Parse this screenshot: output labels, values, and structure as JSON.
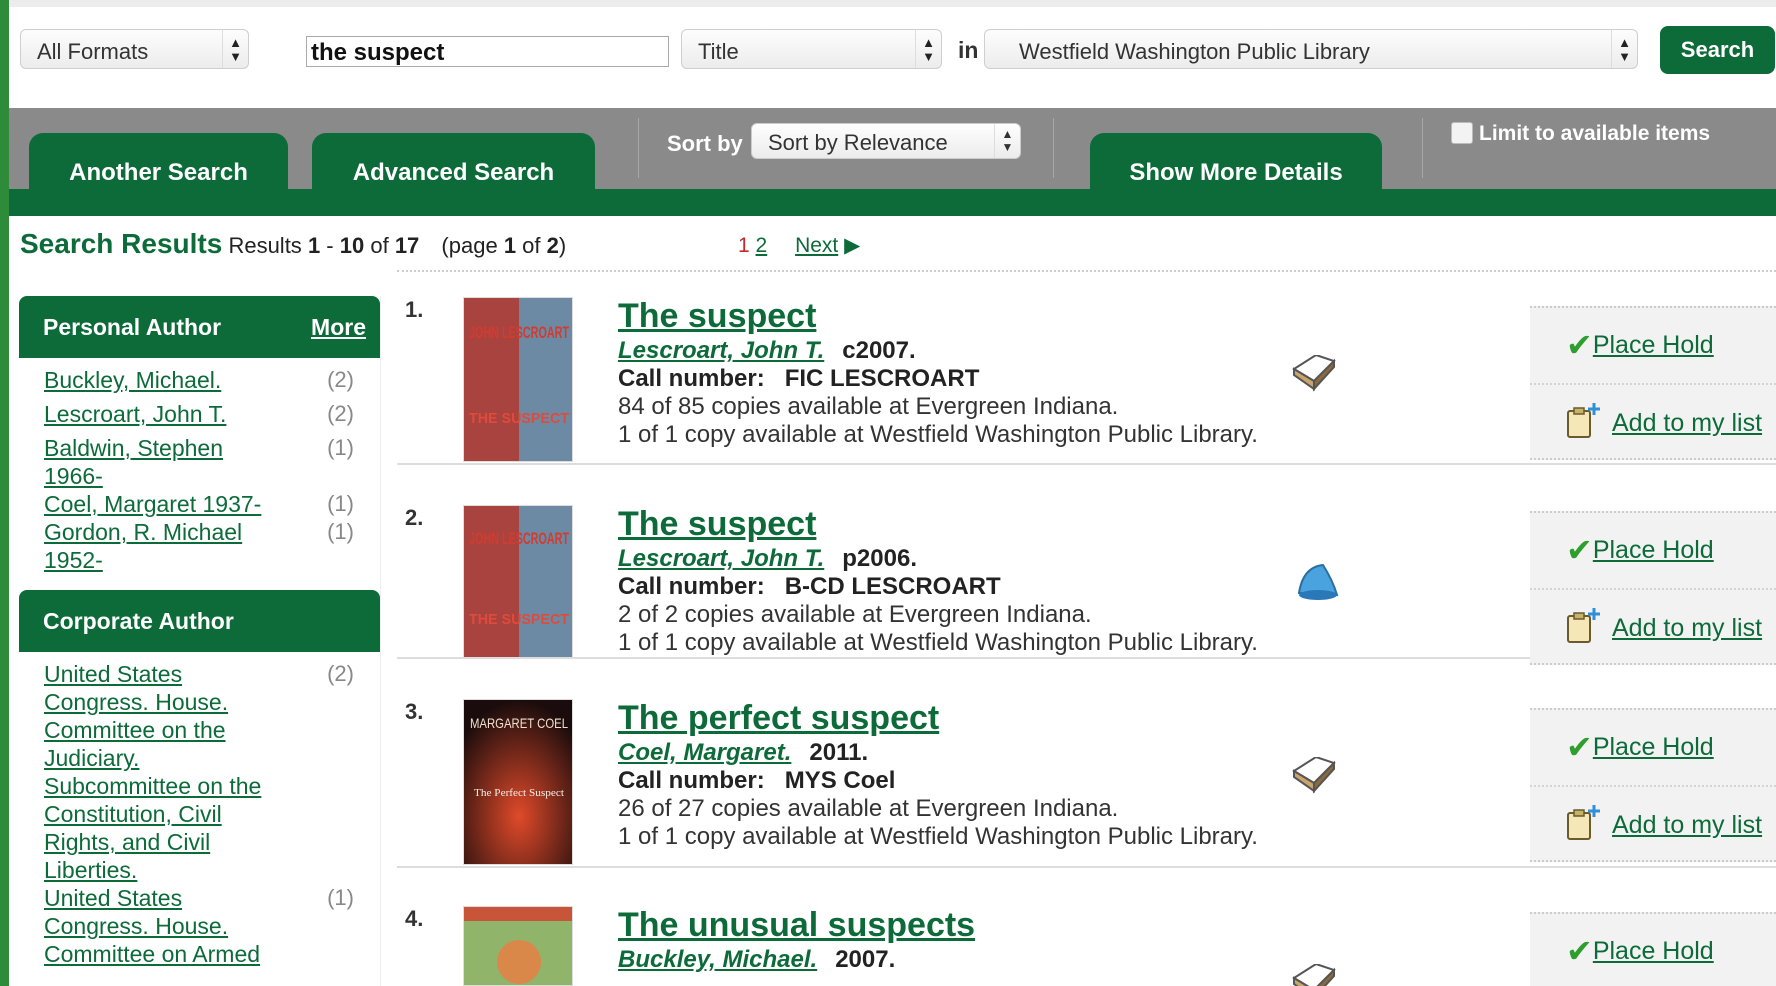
{
  "searchbar": {
    "format_value": "All Formats",
    "query_value": "the suspect",
    "field_value": "Title",
    "in_label": "in",
    "library_value": "Westfield Washington Public Library",
    "search_label": "Search"
  },
  "tabs": {
    "another_search": "Another Search",
    "advanced_search": "Advanced Search",
    "sort_label": "Sort by",
    "sort_value": "Sort by Relevance",
    "show_more": "Show More Details",
    "limit_label": "Limit to available items"
  },
  "summary": {
    "lead": "Search Results",
    "results_text": "Results",
    "range_start": "1",
    "range_sep": " - ",
    "range_end": "10",
    "of_text": " of ",
    "total": "17",
    "page_open": "(page ",
    "page_cur": "1",
    "page_of": " of ",
    "page_total": "2",
    "page_close": ")",
    "pager_current": "1",
    "pager_page2": "2",
    "pager_next": "Next"
  },
  "facets": {
    "personal_author": {
      "title": "Personal Author",
      "more": "More",
      "items": [
        {
          "name": "Buckley, Michael.",
          "count": "(2)"
        },
        {
          "name": "Lescroart, John T.",
          "count": "(2)"
        },
        {
          "name": "Baldwin, Stephen 1966-",
          "count": "(1)"
        },
        {
          "name": "Coel, Margaret 1937-",
          "count": "(1)"
        },
        {
          "name": "Gordon, R. Michael 1952-",
          "count": "(1)"
        }
      ]
    },
    "corporate_author": {
      "title": "Corporate Author",
      "items": [
        {
          "name": "United States Congress. House. Committee on the Judiciary. Subcommittee on the Constitution, Civil Rights, and Civil Liberties.",
          "count": "(2)"
        },
        {
          "name": "United States Congress. House. Committee on Armed",
          "count": "(1)"
        }
      ]
    }
  },
  "results": [
    {
      "num": "1.",
      "title": "The suspect",
      "author": "Lescroart, John T.",
      "date": "c2007.",
      "call_label": "Call number:",
      "call_value": "FIC LESCROART",
      "avail1": "84 of 85 copies available at Evergreen Indiana.",
      "avail2": "1 of 1 copy available at Westfield Washington Public Library.",
      "format_icon": "book-icon",
      "cover_title": "THE SUSPECT",
      "cover_author": "JOHN LESCROART",
      "place_hold": "Place Hold",
      "add_list": "Add to my list"
    },
    {
      "num": "2.",
      "title": "The suspect",
      "author": "Lescroart, John T.",
      "date": "p2006.",
      "call_label": "Call number:",
      "call_value": "B-CD LESCROART",
      "avail1": "2 of 2 copies available at Evergreen Indiana.",
      "avail2": "1 of 1 copy available at Westfield Washington Public Library.",
      "format_icon": "audio-horn-icon",
      "cover_title": "THE SUSPECT",
      "cover_author": "JOHN LESCROART",
      "place_hold": "Place Hold",
      "add_list": "Add to my list"
    },
    {
      "num": "3.",
      "title": "The perfect suspect",
      "author": "Coel, Margaret.",
      "date": "2011.",
      "call_label": "Call number:",
      "call_value": "MYS Coel",
      "avail1": "26 of 27 copies available at Evergreen Indiana.",
      "avail2": "1 of 1 copy available at Westfield Washington Public Library.",
      "format_icon": "book-icon",
      "cover_title": "The Perfect Suspect",
      "cover_author": "MARGARET COEL",
      "place_hold": "Place Hold",
      "add_list": "Add to my list"
    },
    {
      "num": "4.",
      "title": "The unusual suspects",
      "author": "Buckley, Michael.",
      "date": "2007.",
      "format_icon": "book-icon",
      "place_hold": "Place Hold"
    }
  ],
  "colors": {
    "brand_green": "#0d6b3a",
    "band_grey": "#8a8a8a",
    "pager_current": "#c62828"
  }
}
